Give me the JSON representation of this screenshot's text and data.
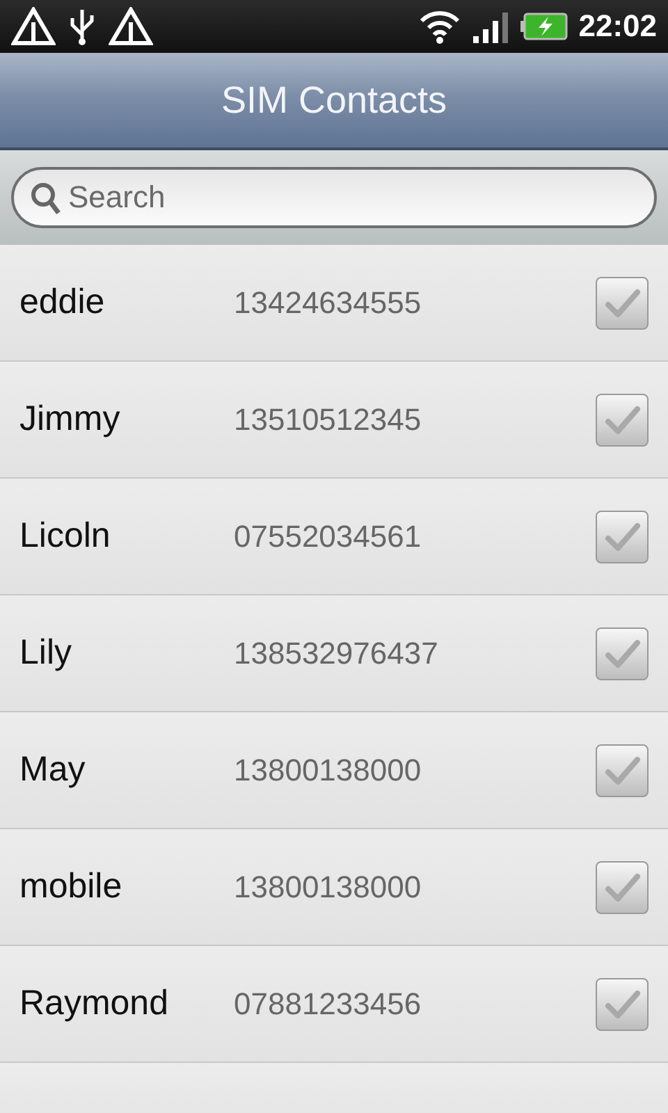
{
  "status_bar": {
    "time": "22:02"
  },
  "title": "SIM Contacts",
  "search": {
    "placeholder": "Search"
  },
  "contacts": [
    {
      "name": "eddie",
      "number": "13424634555",
      "checked": false
    },
    {
      "name": "Jimmy",
      "number": "13510512345",
      "checked": false
    },
    {
      "name": "Licoln",
      "number": "07552034561",
      "checked": false
    },
    {
      "name": "Lily",
      "number": "138532976437",
      "checked": false
    },
    {
      "name": "May",
      "number": "13800138000",
      "checked": false
    },
    {
      "name": "mobile",
      "number": "13800138000",
      "checked": false
    },
    {
      "name": "Raymond",
      "number": "07881233456",
      "checked": false
    }
  ]
}
